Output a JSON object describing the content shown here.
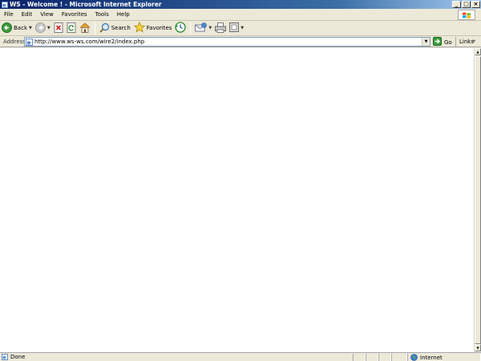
{
  "window": {
    "title": "WS - Welcome ! - Microsoft Internet Explorer",
    "buttons": {
      "minimize": "_",
      "maximize": "□",
      "close": "×"
    }
  },
  "menu": {
    "items": [
      {
        "label": "File"
      },
      {
        "label": "Edit"
      },
      {
        "label": "View"
      },
      {
        "label": "Favorites"
      },
      {
        "label": "Tools"
      },
      {
        "label": "Help"
      }
    ]
  },
  "toolbar": {
    "back_label": "Back",
    "search_label": "Search",
    "favorites_label": "Favorites"
  },
  "address": {
    "label": "Address",
    "url": "http://www.ws-ws.com/wire2/index.php",
    "go_label": "Go",
    "links_label": "Links",
    "links_chevron": "»"
  },
  "status": {
    "text": "Done",
    "zone": "Internet"
  },
  "colors": {
    "titlebar_start": "#0a246a",
    "titlebar_end": "#a6caf0",
    "chrome": "#ece9d8",
    "content_bg": "#ffffff"
  },
  "icons": [
    "ie-page-icon",
    "windows-flag-icon",
    "back-arrow-icon",
    "forward-arrow-icon",
    "stop-icon",
    "refresh-icon",
    "home-icon",
    "search-icon",
    "favorites-star-icon",
    "history-icon",
    "mail-icon",
    "print-icon",
    "edit-icon",
    "go-arrow-icon",
    "globe-icon"
  ]
}
